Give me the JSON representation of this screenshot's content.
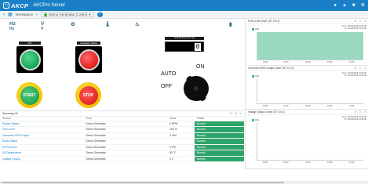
{
  "topbar": {
    "logo": "AKCP",
    "app_title": "AKCPro Server",
    "icons": [
      "bell-icon",
      "speaker-icon",
      "user-icon",
      "settings-icon"
    ]
  },
  "toolbar": {
    "workspace_label": "Workspace",
    "desktop_label": "Demo Generator Control",
    "add_icon": "+"
  },
  "icons_row": [
    "Hz",
    "V",
    "Hz",
    "V",
    "engine-icon",
    "temp-icon",
    "oil-icon",
    "battery-icon"
  ],
  "indicators": [
    {
      "label": "ATS",
      "state": "green"
    },
    {
      "label": "Generator Status",
      "state": "red"
    }
  ],
  "push_buttons": [
    {
      "label": "START",
      "color": "green"
    },
    {
      "label": "STOP",
      "color": "red"
    }
  ],
  "runtime": {
    "title": "Total Runtime (hrs min)",
    "value": "0"
  },
  "switch": {
    "on_label": "ON",
    "auto_label": "AUTO",
    "off_label": "OFF"
  },
  "summary": {
    "title": "Summary W",
    "columns": [
      "Sensor",
      "Host",
      "Value",
      "Status"
    ],
    "rows": [
      {
        "sensor": "Engine Speed",
        "host": "Demo Generator",
        "value": "0 RPM",
        "status": "Normal"
      },
      {
        "sensor": "Fuel Level",
        "host": "Demo Generator",
        "value": "100 %",
        "status": "Normal"
      },
      {
        "sensor": "Generator RVB Output",
        "host": "Demo Generator",
        "value": "0 VAC",
        "status": "Normal"
      },
      {
        "sensor": "Mode Status",
        "host": "Demo Generator",
        "value": "",
        "status": "Normal"
      },
      {
        "sensor": "Oil Pressure",
        "host": "Demo Generator",
        "value": "0 PSI",
        "status": "Normal"
      },
      {
        "sensor": "Oil Temperature",
        "host": "Demo Generator",
        "value": "50 °C",
        "status": "Normal"
      },
      {
        "sensor": "Voltage Output",
        "host": "Demo Generator",
        "value": "0 V",
        "status": "Normal"
      }
    ]
  },
  "charts": [
    {
      "title": "Fuel Level Chart '(ST 0:0:1)'",
      "range_from": "From: 04/13/2018 15:08:48",
      "range_to": "To: 04/13/2018 15:48:48",
      "legend": "Unit",
      "x_ticks": [
        "15:06",
        "15:10",
        "15:20",
        "15:30",
        "15:40"
      ],
      "fill_fraction": 1.0
    },
    {
      "title": "Generator RVB Output Chart '(ST 0:0:1)'",
      "range_from": "From: 04/13/2018 15:08:48",
      "range_to": "To: 04/13/2018 15:48:48",
      "legend": "Unit",
      "x_ticks": [
        "15:06",
        "15:10",
        "15:20",
        "15:30",
        "15:40"
      ],
      "fill_fraction": 0
    },
    {
      "title": "Voltage Output Chart '(ST 0:0:1)'",
      "range_from": "From: 04/13/2018 15:08:48",
      "range_to": "To: 04/13/2018 15:48:48",
      "legend": "Unit",
      "x_ticks": [
        "15:06",
        "15:10",
        "15:20",
        "15:30",
        "15:40"
      ],
      "fill_fraction": 0
    }
  ],
  "colors": {
    "topbar": "#1a7fc6",
    "status_normal": "#2fa46a",
    "chart_fill": "#9ad9c0",
    "lamp_green": "#12a455",
    "lamp_red": "#e21b1b",
    "button_ring": "#f2c200"
  }
}
